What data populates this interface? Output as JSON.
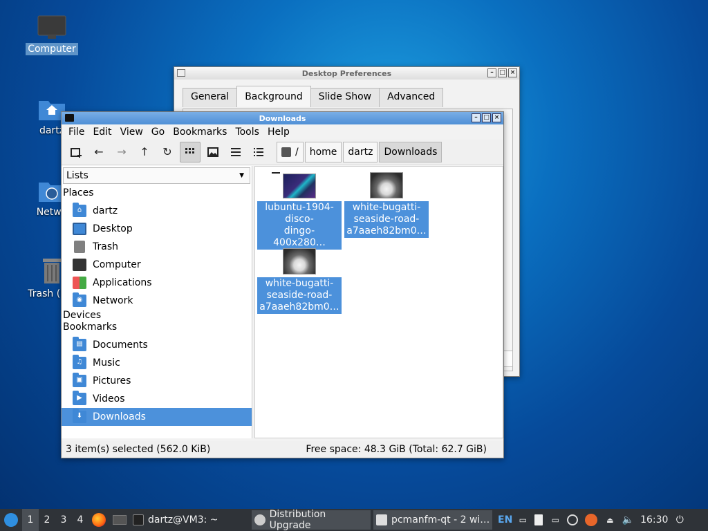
{
  "desktop": {
    "icons": [
      {
        "label": "Computer",
        "icon": "computer-icon"
      },
      {
        "label": "dartz",
        "icon": "home-folder-icon"
      },
      {
        "label": "Netwo",
        "icon": "network-folder-icon"
      },
      {
        "label": "Trash (Em",
        "icon": "trash-icon"
      }
    ]
  },
  "prefs_window": {
    "title": "Desktop Preferences",
    "tabs": [
      "General",
      "Background",
      "Slide Show",
      "Advanced"
    ],
    "active_tab": "Background"
  },
  "fm_window": {
    "title": "Downloads",
    "menu": [
      "File",
      "Edit",
      "View",
      "Go",
      "Bookmarks",
      "Tools",
      "Help"
    ],
    "toolbar_icons": [
      "new-tab-icon",
      "back-icon",
      "forward-icon",
      "up-icon",
      "reload-icon",
      "icon-view-icon",
      "thumbnail-view-icon",
      "compact-view-icon",
      "detailed-list-view-icon"
    ],
    "path": {
      "root": "/",
      "segments": [
        "home",
        "dartz",
        "Downloads"
      ]
    },
    "sidebar": {
      "mode": "Lists",
      "places_header": "Places",
      "places": [
        {
          "label": "dartz",
          "icon": "home-folder-icon"
        },
        {
          "label": "Desktop",
          "icon": "desktop-icon"
        },
        {
          "label": "Trash",
          "icon": "trash-icon"
        },
        {
          "label": "Computer",
          "icon": "computer-icon"
        },
        {
          "label": "Applications",
          "icon": "applications-icon"
        },
        {
          "label": "Network",
          "icon": "network-folder-icon"
        }
      ],
      "devices_header": "Devices",
      "bookmarks_header": "Bookmarks",
      "bookmarks": [
        {
          "label": "Documents",
          "icon": "documents-folder-icon"
        },
        {
          "label": "Music",
          "icon": "music-folder-icon"
        },
        {
          "label": "Pictures",
          "icon": "pictures-folder-icon"
        },
        {
          "label": "Videos",
          "icon": "videos-folder-icon"
        },
        {
          "label": "Downloads",
          "icon": "downloads-folder-icon",
          "selected": true
        }
      ]
    },
    "files": [
      {
        "line1": "lubuntu-1904-",
        "line2": "disco-",
        "line3": "dingo-400x280…"
      },
      {
        "line1": "white-bugatti-",
        "line2": "seaside-road-",
        "line3": "a7aaeh82bm0…"
      },
      {
        "line1": "white-bugatti-",
        "line2": "seaside-road-",
        "line3": "a7aaeh82bm0…"
      }
    ],
    "status": {
      "selection": "3 item(s) selected (562.0 KiB)",
      "free_space": "Free space: 48.3 GiB (Total: 62.7 GiB)"
    }
  },
  "taskbar": {
    "workspaces": [
      "1",
      "2",
      "3",
      "4"
    ],
    "active_workspace": "1",
    "tasks": [
      {
        "label": "dartz@VM3: ~",
        "icon": "terminal-icon"
      },
      {
        "label": "Distribution Upgrade",
        "icon": "upgrade-icon"
      },
      {
        "label": "pcmanfm-qt - 2 wi…",
        "icon": "window-icon"
      }
    ],
    "keyboard_layout": "EN",
    "clock": "16:30"
  },
  "colors": {
    "selection": "#4c91db",
    "titlebar_active": "#5a97da",
    "taskbar": "#2f3338"
  }
}
